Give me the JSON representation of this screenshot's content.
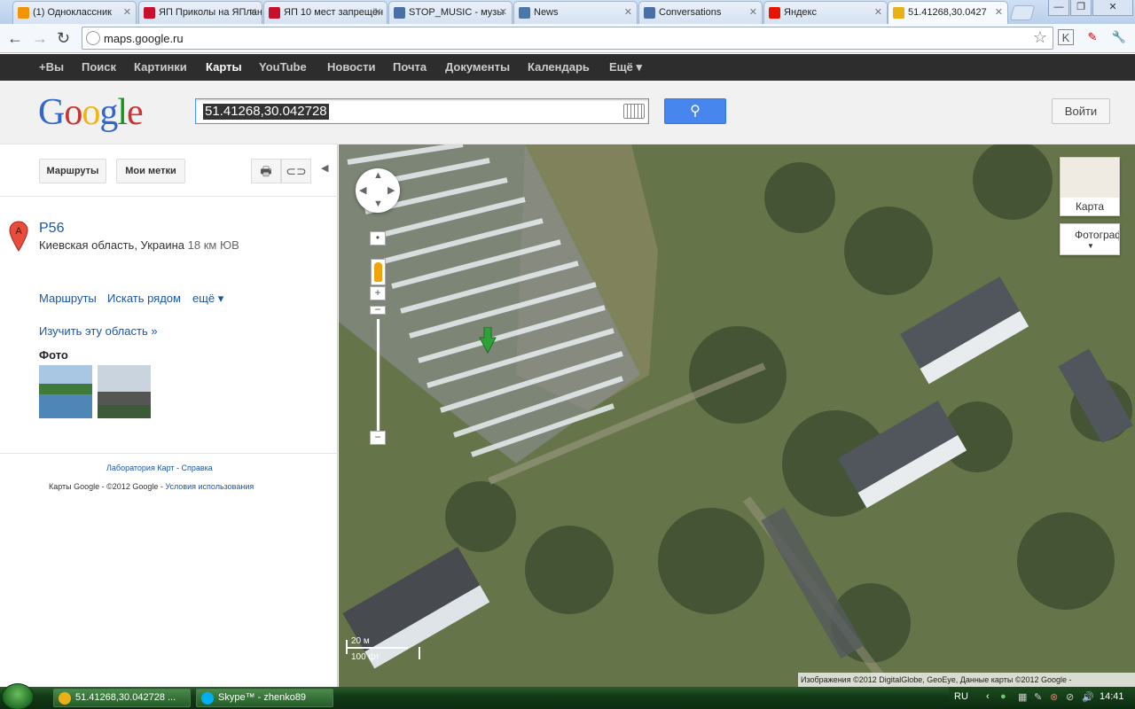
{
  "browser": {
    "tabs": [
      {
        "title": "(1) Одноклассник",
        "favicon_color": "#f29400"
      },
      {
        "title": "ЯП Приколы на ЯПлан",
        "favicon_color": "#c8102e"
      },
      {
        "title": "ЯП 10 мест запрещён",
        "favicon_color": "#c8102e"
      },
      {
        "title": "STOP_MUSIC - музы",
        "favicon_color": "#4a6fa5"
      },
      {
        "title": "News",
        "favicon_color": "#4a76a8"
      },
      {
        "title": "Conversations",
        "favicon_color": "#4a6fa5"
      },
      {
        "title": "Яндекс",
        "favicon_color": "#e61400"
      },
      {
        "title": "51.41268,30.0427",
        "favicon_color": "#e9b116"
      }
    ],
    "url": "maps.google.ru"
  },
  "gbar": {
    "items": [
      "+Вы",
      "Поиск",
      "Картинки",
      "Карты",
      "YouTube",
      "Новости",
      "Почта",
      "Документы",
      "Календарь",
      "Ещё ▾"
    ],
    "selected": "Карты"
  },
  "header": {
    "logo": "Google",
    "search_value": "51.41268,30.042728",
    "login": "Войти"
  },
  "panel": {
    "buttons": {
      "routes": "Маршруты",
      "my_places": "Мои метки"
    },
    "place": {
      "marker_letter": "A",
      "title": "Р56",
      "address": "Киевская область, Украина",
      "distance": "18 км ЮВ"
    },
    "links": {
      "routes": "Маршруты",
      "search_nearby": "Искать рядом",
      "more": "ещё ▾",
      "explore": "Изучить эту область »"
    },
    "photos_title": "Фото",
    "footer": {
      "lab": "Лаборатория Карт",
      "sep": " - ",
      "help": "Справка",
      "copyright": "Карты Google - ©2012 Google - ",
      "terms": "Условия использования"
    }
  },
  "map": {
    "maptype_map": "Карта",
    "maptype_photo": "Фотография",
    "scale_metric": "20 м",
    "scale_imperial": "100 фт",
    "attribution": "Изображения ©2012 DigitalGlobe, GeoEye, Данные карты ©2012 Google -"
  },
  "taskbar": {
    "items": [
      {
        "label": "51.41268,30.042728 ...",
        "icon_color": "#e9b116"
      },
      {
        "label": "Skype™ - zhenko89",
        "icon_color": "#00aff0"
      }
    ],
    "language": "RU",
    "time": "14:41"
  }
}
